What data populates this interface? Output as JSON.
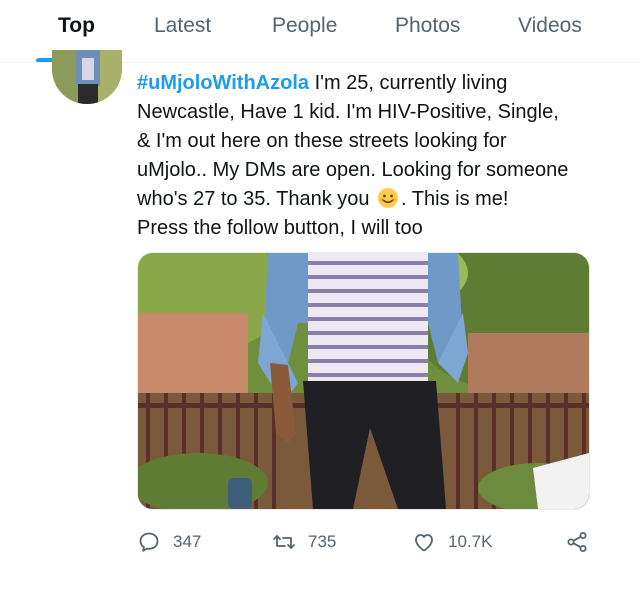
{
  "tabs": [
    {
      "label": "Top",
      "active": true
    },
    {
      "label": "Latest",
      "active": false
    },
    {
      "label": "People",
      "active": false
    },
    {
      "label": "Photos",
      "active": false
    },
    {
      "label": "Videos",
      "active": false
    }
  ],
  "tweet": {
    "hashtag": "#uMjoloWithAzola",
    "text_line1": " I'm 25, currently living",
    "text_line2": "Newcastle, Have 1 kid. I'm HIV-Positive, Single,",
    "text_line3": "& I'm out here on these streets looking for",
    "text_line4": "uMjolo.. My DMs are open. Looking for someone",
    "text_line5a": "who's 27 to 35. Thank you ",
    "text_line5b": ".  This is me!",
    "text_line6": "Press the follow button, I will too",
    "emoji": "smiling-face-emoji"
  },
  "actions": {
    "replies": "347",
    "retweets": "735",
    "likes": "10.7K",
    "reply_icon": "speech-bubble-icon",
    "retweet_icon": "retweet-arrows-icon",
    "like_icon": "heart-icon",
    "share_icon": "share-icon"
  },
  "colors": {
    "accent": "#1d9bf0",
    "text": "#0f1419",
    "muted": "#536471"
  }
}
